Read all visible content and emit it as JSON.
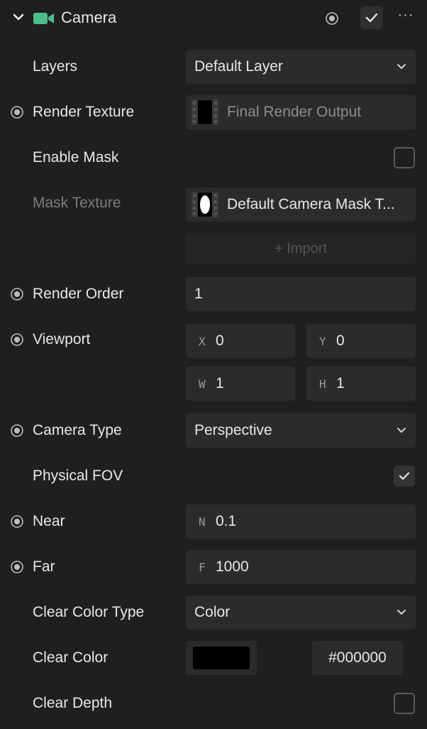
{
  "header": {
    "title": "Camera",
    "icon": "camera-icon",
    "accent": "#4dbd8c",
    "more_label": "···"
  },
  "rows": {
    "layers": {
      "label": "Layers",
      "value": "Default Layer"
    },
    "render_texture": {
      "label": "Render Texture",
      "value": "Final Render Output"
    },
    "enable_mask": {
      "label": "Enable Mask",
      "checked": false
    },
    "mask_texture": {
      "label": "Mask Texture",
      "value": "Default Camera Mask T..."
    },
    "import": {
      "label": "+ Import"
    },
    "render_order": {
      "label": "Render Order",
      "value": "1"
    },
    "viewport": {
      "label": "Viewport",
      "x_prefix": "X",
      "x": "0",
      "y_prefix": "Y",
      "y": "0",
      "w_prefix": "W",
      "w": "1",
      "h_prefix": "H",
      "h": "1"
    },
    "camera_type": {
      "label": "Camera Type",
      "value": "Perspective"
    },
    "physical_fov": {
      "label": "Physical FOV",
      "checked": true
    },
    "near": {
      "label": "Near",
      "prefix": "N",
      "value": "0.1"
    },
    "far": {
      "label": "Far",
      "prefix": "F",
      "value": "1000"
    },
    "clear_color_type": {
      "label": "Clear Color Type",
      "value": "Color"
    },
    "clear_color": {
      "label": "Clear Color",
      "swatch": "#000000",
      "hex": "#000000"
    },
    "clear_depth": {
      "label": "Clear Depth",
      "checked": false
    }
  }
}
